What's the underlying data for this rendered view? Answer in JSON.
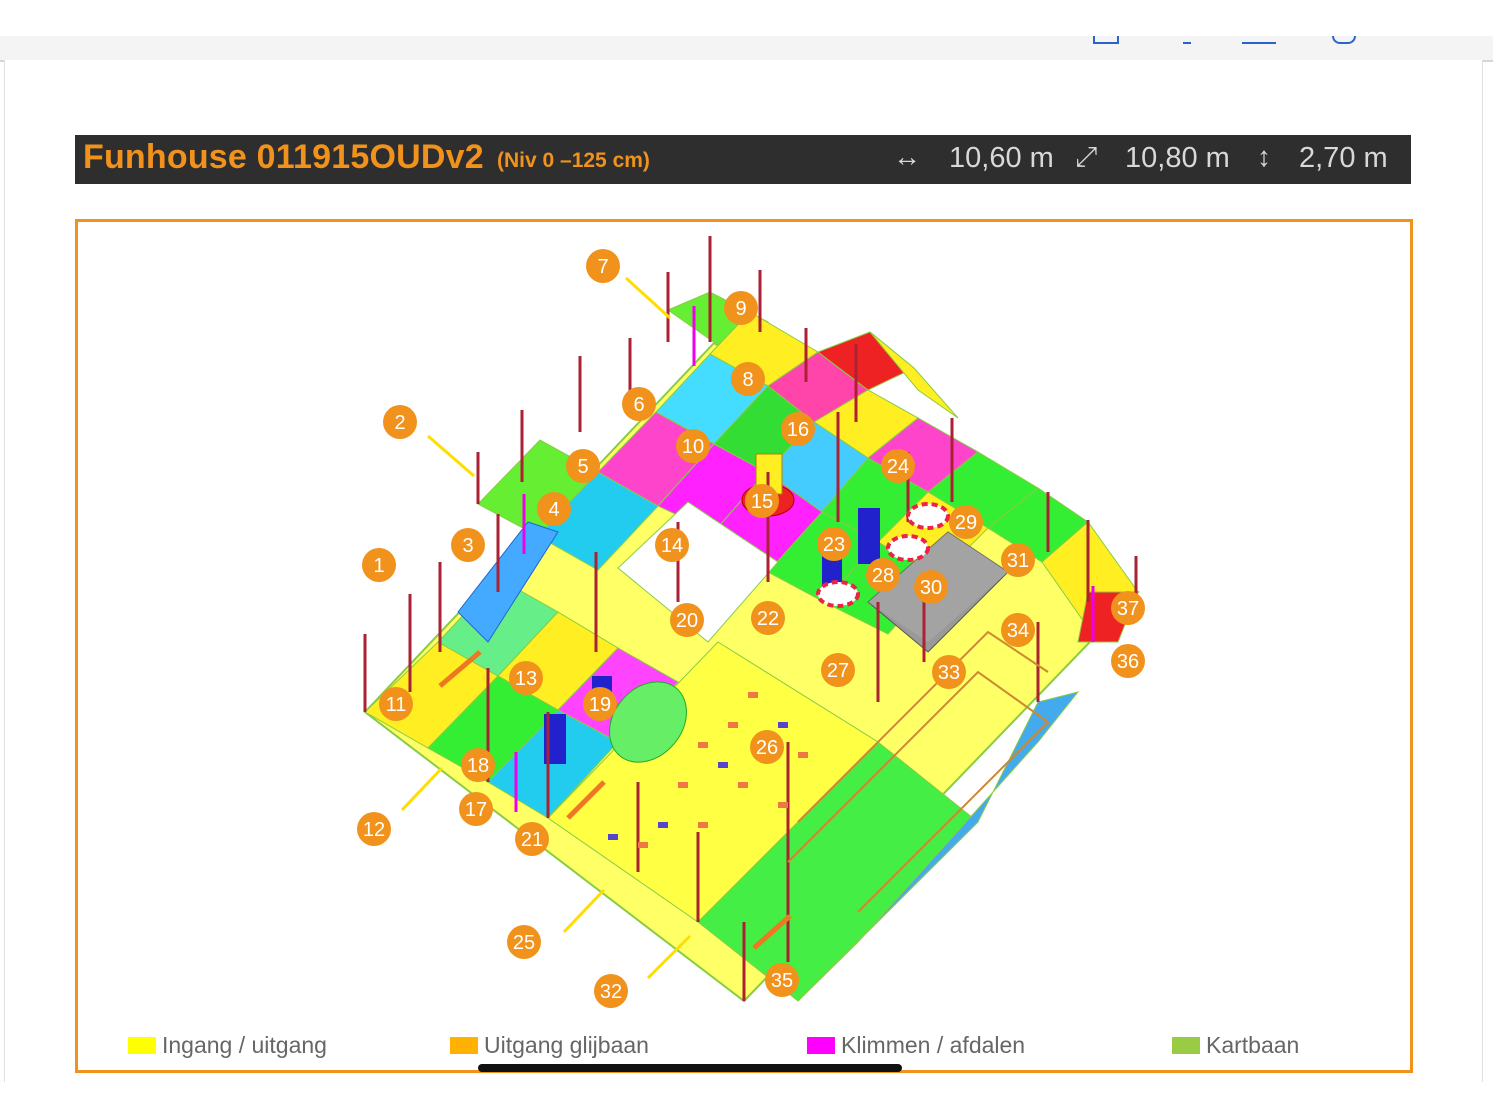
{
  "header": {
    "title": "Funhouse 011915OUDv2",
    "subtitle": "(Niv 0 –125 cm)",
    "width_value": "10,60 m",
    "depth_value": "10,80 m",
    "height_value": "2,70 m",
    "width_icon": "horizontal-arrow-icon",
    "depth_icon": "diagonal-arrow-icon",
    "height_icon": "vertical-arrow-icon"
  },
  "colors": {
    "accent": "#f0921c",
    "title_bar": "#2e2e2e",
    "ingang": "#ffff00",
    "uitgang_glijbaan": "#ffb000",
    "klimmen": "#ff00ff",
    "kartbaan": "#99cc44"
  },
  "diagram": {
    "markers": [
      "1",
      "2",
      "3",
      "4",
      "5",
      "6",
      "7",
      "8",
      "9",
      "10",
      "11",
      "12",
      "13",
      "14",
      "15",
      "16",
      "17",
      "18",
      "19",
      "20",
      "21",
      "22",
      "23",
      "24",
      "25",
      "26",
      "27",
      "28",
      "29",
      "30",
      "31",
      "32",
      "33",
      "34",
      "35",
      "36",
      "37"
    ]
  },
  "legend": {
    "items": [
      {
        "label": "Ingang / uitgang",
        "color": "#ffff00"
      },
      {
        "label": "Uitgang glijbaan",
        "color": "#ffb000"
      },
      {
        "label": "Klimmen / afdalen",
        "color": "#ff00ff"
      },
      {
        "label": "Kartbaan",
        "color": "#99cc44"
      }
    ]
  }
}
